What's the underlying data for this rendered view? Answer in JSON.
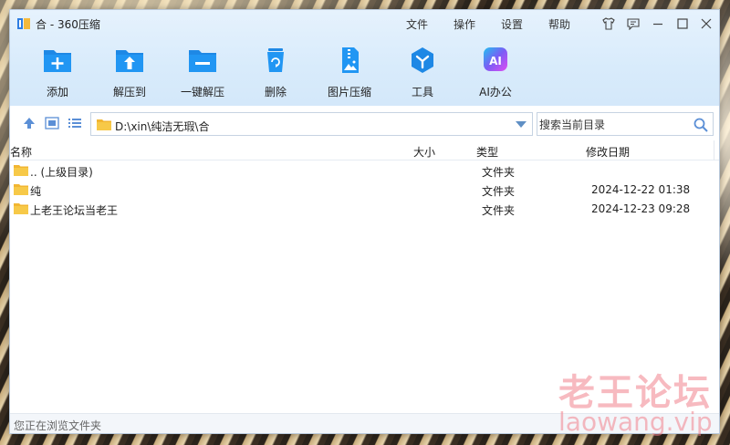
{
  "window": {
    "title": "合 - 360压缩"
  },
  "menu": {
    "file": "文件",
    "operate": "操作",
    "settings": "设置",
    "help": "帮助"
  },
  "toolbar": [
    {
      "label": "添加",
      "icon": "add-icon"
    },
    {
      "label": "解压到",
      "icon": "extract-to-icon"
    },
    {
      "label": "一键解压",
      "icon": "one-click-extract-icon"
    },
    {
      "label": "删除",
      "icon": "delete-icon"
    },
    {
      "label": "图片压缩",
      "icon": "image-compress-icon"
    },
    {
      "label": "工具",
      "icon": "tools-icon"
    },
    {
      "label": "AI办公",
      "icon": "ai-office-icon"
    }
  ],
  "address": {
    "path": "D:\\xin\\纯洁无瑕\\合"
  },
  "search": {
    "placeholder": "搜索当前目录"
  },
  "columns": {
    "name": "名称",
    "size": "大小",
    "type": "类型",
    "date": "修改日期"
  },
  "files": [
    {
      "name": ".. (上级目录)",
      "type": "文件夹",
      "date": ""
    },
    {
      "name": "纯",
      "type": "文件夹",
      "date": "2024-12-22 01:38"
    },
    {
      "name": "上老王论坛当老王",
      "type": "文件夹",
      "date": "2024-12-23 09:28"
    }
  ],
  "status": "您正在浏览文件夹",
  "watermark": {
    "title": "老王论坛",
    "url": "laowang.vip"
  },
  "colors": {
    "accent": "#1e88e5",
    "folder": "#f6c342",
    "ai": "#8e44ef"
  }
}
